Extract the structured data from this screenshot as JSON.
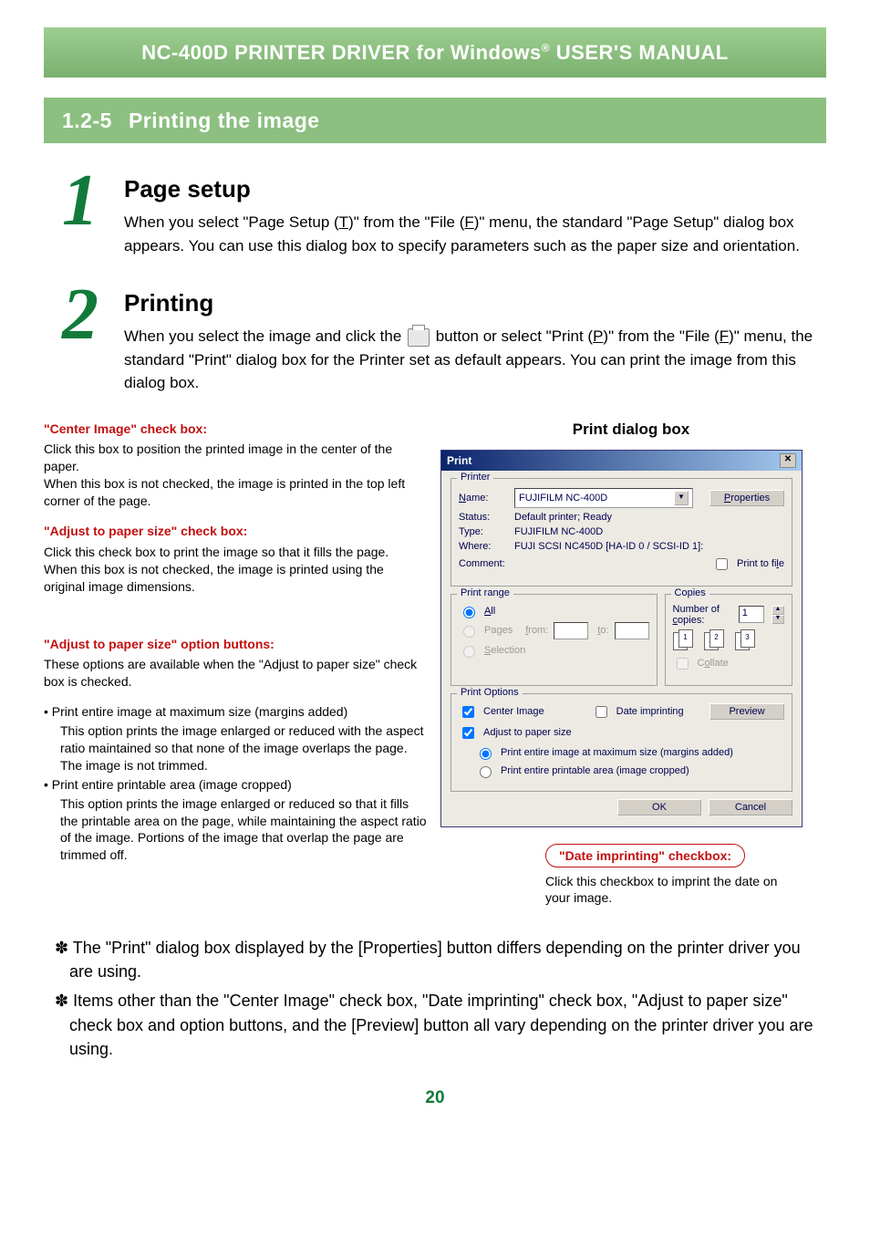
{
  "header": {
    "title_pre": "NC-400D PRINTER DRIVER for Windows",
    "title_sup": "®",
    "title_post": " USER'S MANUAL"
  },
  "section": {
    "number": "1.2-5",
    "title": "Printing the image"
  },
  "steps": [
    {
      "num": "1",
      "title": "Page setup",
      "text_pre": "When you select \"Page Setup (",
      "u1": "T",
      "text_mid1": ")\" from the \"File (",
      "u2": "F",
      "text_post": ")\" menu, the standard \"Page Setup\" dialog box appears. You can use this dialog box to specify parameters such as the paper size and orientation."
    },
    {
      "num": "2",
      "title": "Printing",
      "text_pre": "When you select the image and click the ",
      "text_mid1": " button or select \"Print (",
      "u1": "P",
      "text_mid2": ")\" from the \"File (",
      "u2": "F",
      "text_post": ")\" menu, the standard \"Print\" dialog box for the Printer set as default appears. You can print the image from this dialog box."
    }
  ],
  "left": {
    "h1": "\"Center Image\" check box:",
    "p1": "Click this box to position the printed image in the center of the paper.",
    "p1b": "When this box is not checked, the image is printed in the top left corner of the page.",
    "h2": "\"Adjust to paper size\" check box:",
    "p2": "Click this check box to print the image so that it fills the page.",
    "p2b": "When this box is not checked, the image is printed using the original image dimensions.",
    "h3": "\"Adjust to paper size\" option buttons:",
    "p3": "These options are available when the \"Adjust to paper size\" check box is checked.",
    "b1_title": "• Print entire image at maximum size (margins added)",
    "b1_body": "This option prints the image enlarged or reduced with the aspect ratio maintained so that none of the image overlaps the page. The image is not trimmed.",
    "b2_title": "• Print entire printable area (image cropped)",
    "b2_body": "This option prints the image enlarged or reduced so that it fills the printable area on the page, while maintaining the aspect ratio of the image. Portions of the image that overlap the page are trimmed off."
  },
  "dialog_caption": "Print dialog box",
  "dialog": {
    "title": "Print",
    "printer_legend": "Printer",
    "name_label": "Name:",
    "name_value": "FUJIFILM NC-400D",
    "properties_btn": "Properties",
    "status_label": "Status:",
    "status_value": "Default printer; Ready",
    "type_label": "Type:",
    "type_value": "FUJIFILM NC-400D",
    "where_label": "Where:",
    "where_value": "FUJI SCSI NC450D [HA-ID 0 / SCSI-ID 1]:",
    "comment_label": "Comment:",
    "print_to_file": "Print to file",
    "range_legend": "Print range",
    "range_all": "All",
    "range_pages": "Pages",
    "range_from": "from:",
    "range_to": "to:",
    "range_selection": "Selection",
    "copies_legend": "Copies",
    "copies_label": "Number of copies:",
    "copies_value": "1",
    "collate": "Collate",
    "opts_legend": "Print Options",
    "opt_center": "Center Image",
    "opt_date": "Date imprinting",
    "opt_adjust": "Adjust to paper size",
    "opt_r1": "Print entire image at maximum size (margins added)",
    "opt_r2": "Print entire printable area (image cropped)",
    "preview_btn": "Preview",
    "ok_btn": "OK",
    "cancel_btn": "Cancel"
  },
  "callout": {
    "title": "\"Date imprinting\" checkbox:",
    "body": "Click this checkbox to imprint the date on your image."
  },
  "notes": {
    "n1": "✽ The \"Print\" dialog box displayed by the [Properties] button differs depending on the printer driver you are using.",
    "n2": "✽ Items other than the \"Center Image\" check box, \"Date imprinting\" check box, \"Adjust to paper size\" check box and option buttons, and the [Preview] button all vary depending on the printer driver you are using."
  },
  "page_number": "20"
}
